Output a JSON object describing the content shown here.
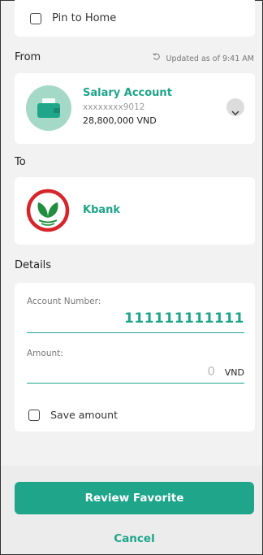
{
  "pin": {
    "label": "Pin to Home"
  },
  "from": {
    "section_label": "From",
    "updated_text": "Updated as of 9:41 AM",
    "account_name": "Salary Account",
    "account_number": "xxxxxxxx9012",
    "balance": "28,800,000 VND"
  },
  "to": {
    "section_label": "To",
    "bank_name": "Kbank"
  },
  "details": {
    "section_label": "Details",
    "account_number_label": "Account Number:",
    "account_number_value": "111111111111",
    "amount_label": "Amount:",
    "amount_value": "0",
    "amount_currency": "VND",
    "save_amount_label": "Save amount"
  },
  "actions": {
    "review_label": "Review Favorite",
    "cancel_label": "Cancel"
  },
  "colors": {
    "accent": "#1ea58a",
    "background": "#f2f2f2",
    "kbank_red": "#d6262b",
    "kbank_green": "#1f8f3f"
  },
  "icons": {
    "pin_checkbox": "checkbox-empty",
    "updated": "refresh-icon",
    "wallet": "wallet-icon",
    "expand": "chevron-down-icon",
    "bank_logo": "kbank-logo"
  }
}
